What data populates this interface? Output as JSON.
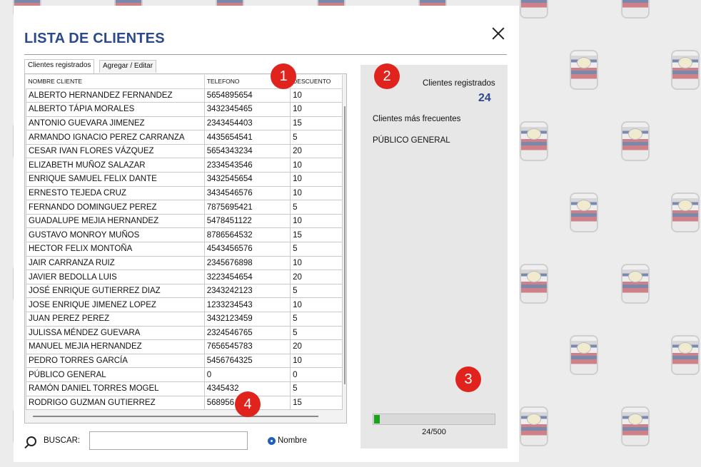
{
  "window": {
    "title": "LISTA DE CLIENTES"
  },
  "tabs": [
    {
      "label": "Clientes registrados",
      "active": true
    },
    {
      "label": "Agregar / Editar",
      "active": false
    }
  ],
  "table": {
    "columns": [
      "NOMBRE CLIENTE",
      "TELEFONO",
      "DESCUENTO"
    ],
    "rows": [
      [
        "ALBERTO HERNANDEZ FERNANDEZ",
        "5654895654",
        "10"
      ],
      [
        "ALBERTO TÁPIA MORALES",
        "3432345465",
        "10"
      ],
      [
        "ANTONIO GUEVARA JIMENEZ",
        "2343454403",
        "15"
      ],
      [
        "ARMANDO IGNACIO PEREZ CARRANZA",
        "4435654541",
        "5"
      ],
      [
        "CESAR IVAN FLORES VÁZQUEZ",
        "5654343234",
        "20"
      ],
      [
        "ELIZABETH MUÑOZ SALAZAR",
        "2334543546",
        "10"
      ],
      [
        "ENRIQUE SAMUEL FELIX DANTE",
        "3432545654",
        "10"
      ],
      [
        "ERNESTO TEJEDA CRUZ",
        "3434546576",
        "10"
      ],
      [
        "FERNANDO DOMINGUEZ PEREZ",
        "7875695421",
        "5"
      ],
      [
        "GUADALUPE MEJIA HERNANDEZ",
        "5478451122",
        "10"
      ],
      [
        "GUSTAVO MONROY MUÑOS",
        "8786564532",
        "15"
      ],
      [
        "HECTOR FELIX MONTOÑA",
        "4543456576",
        "5"
      ],
      [
        "JAIR CARRANZA RUIZ",
        "2345676898",
        "10"
      ],
      [
        "JAVIER BEDOLLA LUIS",
        "3223454654",
        "20"
      ],
      [
        "JOSÉ ENRIQUE GUTIERREZ DIAZ",
        "2343242123",
        "5"
      ],
      [
        "JOSE ENRIQUE JIMENEZ LOPEZ",
        "1233234543",
        "10"
      ],
      [
        "JUAN PEREZ PEREZ",
        "3432123459",
        "5"
      ],
      [
        "JULISSA MÉNDEZ GUEVARA",
        "2324546765",
        "5"
      ],
      [
        "MANUEL MEJIA HERNANDEZ",
        "7656545783",
        "20"
      ],
      [
        "PEDRO TORRES GARCÍA",
        "5456764325",
        "10"
      ],
      [
        "PÚBLICO GENERAL",
        "0",
        "0"
      ],
      [
        "RAMÓN DANIEL TORRES MOGEL",
        "4345432",
        "5"
      ],
      [
        "RODRIGO GUZMAN GUTIERREZ",
        "568956",
        "15"
      ]
    ]
  },
  "search": {
    "label": "BUSCAR:",
    "value": "",
    "placeholder": "",
    "option_label": "Nombre"
  },
  "side_panel": {
    "registered_label": "Clientes registrados",
    "registered_count": "24",
    "frequent_label": "Clientes más frecuentes",
    "frequent_client": "PÚBLICO GENERAL",
    "progress_fraction": 0.048,
    "progress_text": "24/500"
  },
  "markers": [
    "1",
    "2",
    "3",
    "4"
  ],
  "colors": {
    "title": "#2c4a8a",
    "marker": "#e0231c",
    "progress": "#1ea21e",
    "radio": "#1f5fbf"
  },
  "icons": {
    "close": "close-icon",
    "search": "search-icon"
  }
}
